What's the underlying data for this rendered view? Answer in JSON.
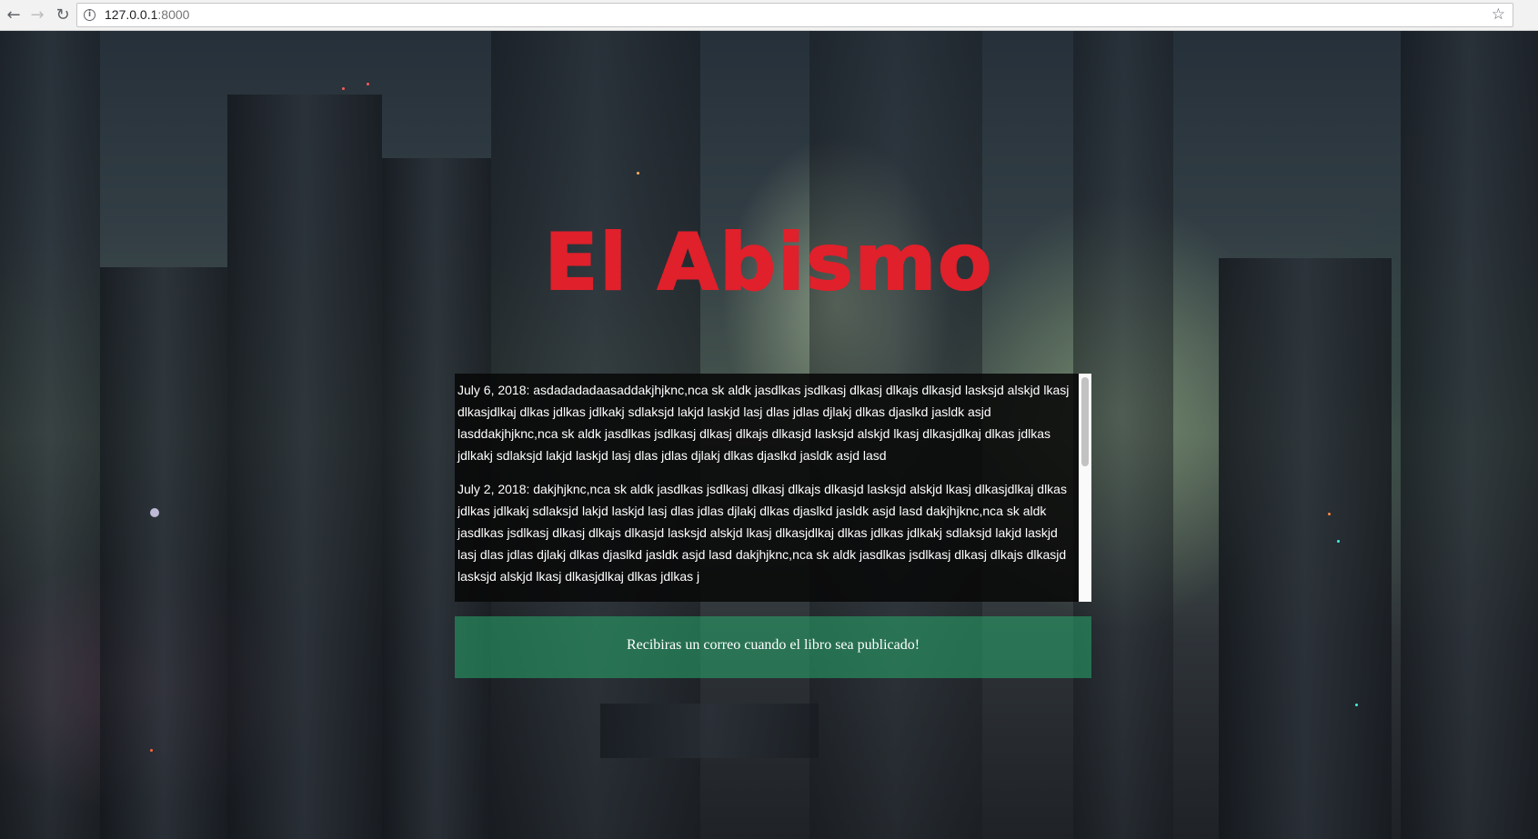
{
  "browser": {
    "url_host": "127.0.0.1",
    "url_port": ":8000",
    "back_icon": "back-arrow-icon",
    "forward_icon": "forward-arrow-icon",
    "reload_icon": "reload-icon",
    "bookmark_icon": "star-icon"
  },
  "page": {
    "title": "El Abismo",
    "title_color": "#e0202b",
    "news": [
      {
        "text": "July 6, 2018: asdadadadaasaddakjhjknc,nca sk aldk jasdlkas jsdlkasj dlkasj dlkajs dlkasjd lasksjd alskjd lkasj dlkasjdlkaj dlkas jdlkas jdlkakj sdlaksjd lakjd laskjd lasj dlas jdlas djlakj dlkas djaslkd jasldk asjd lasddakjhjknc,nca sk aldk jasdlkas jsdlkasj dlkasj dlkajs dlkasjd lasksjd alskjd lkasj dlkasjdlkaj dlkas jdlkas jdlkakj sdlaksjd lakjd laskjd lasj dlas jdlas djlakj dlkas djaslkd jasldk asjd lasd"
      },
      {
        "text": "July 2, 2018: dakjhjknc,nca sk aldk jasdlkas jsdlkasj dlkasj dlkajs dlkasjd lasksjd alskjd lkasj dlkasjdlkaj dlkas jdlkas jdlkakj sdlaksjd lakjd laskjd lasj dlas jdlas djlakj dlkas djaslkd jasldk asjd lasd dakjhjknc,nca sk aldk jasdlkas jsdlkasj dlkasj dlkajs dlkasjd lasksjd alskjd lkasj dlkasjdlkaj dlkas jdlkas jdlkakj sdlaksjd lakjd laskjd lasj dlas jdlas djlakj dlkas djaslkd jasldk asjd lasd dakjhjknc,nca sk aldk jasdlkas jsdlkasj dlkasj dlkajs dlkasjd lasksjd alskjd lkasj dlkasjdlkaj dlkas jdlkas j"
      }
    ],
    "notice": "Recibiras un correo cuando el libro sea publicado!",
    "notice_color": "#28aa6e"
  }
}
